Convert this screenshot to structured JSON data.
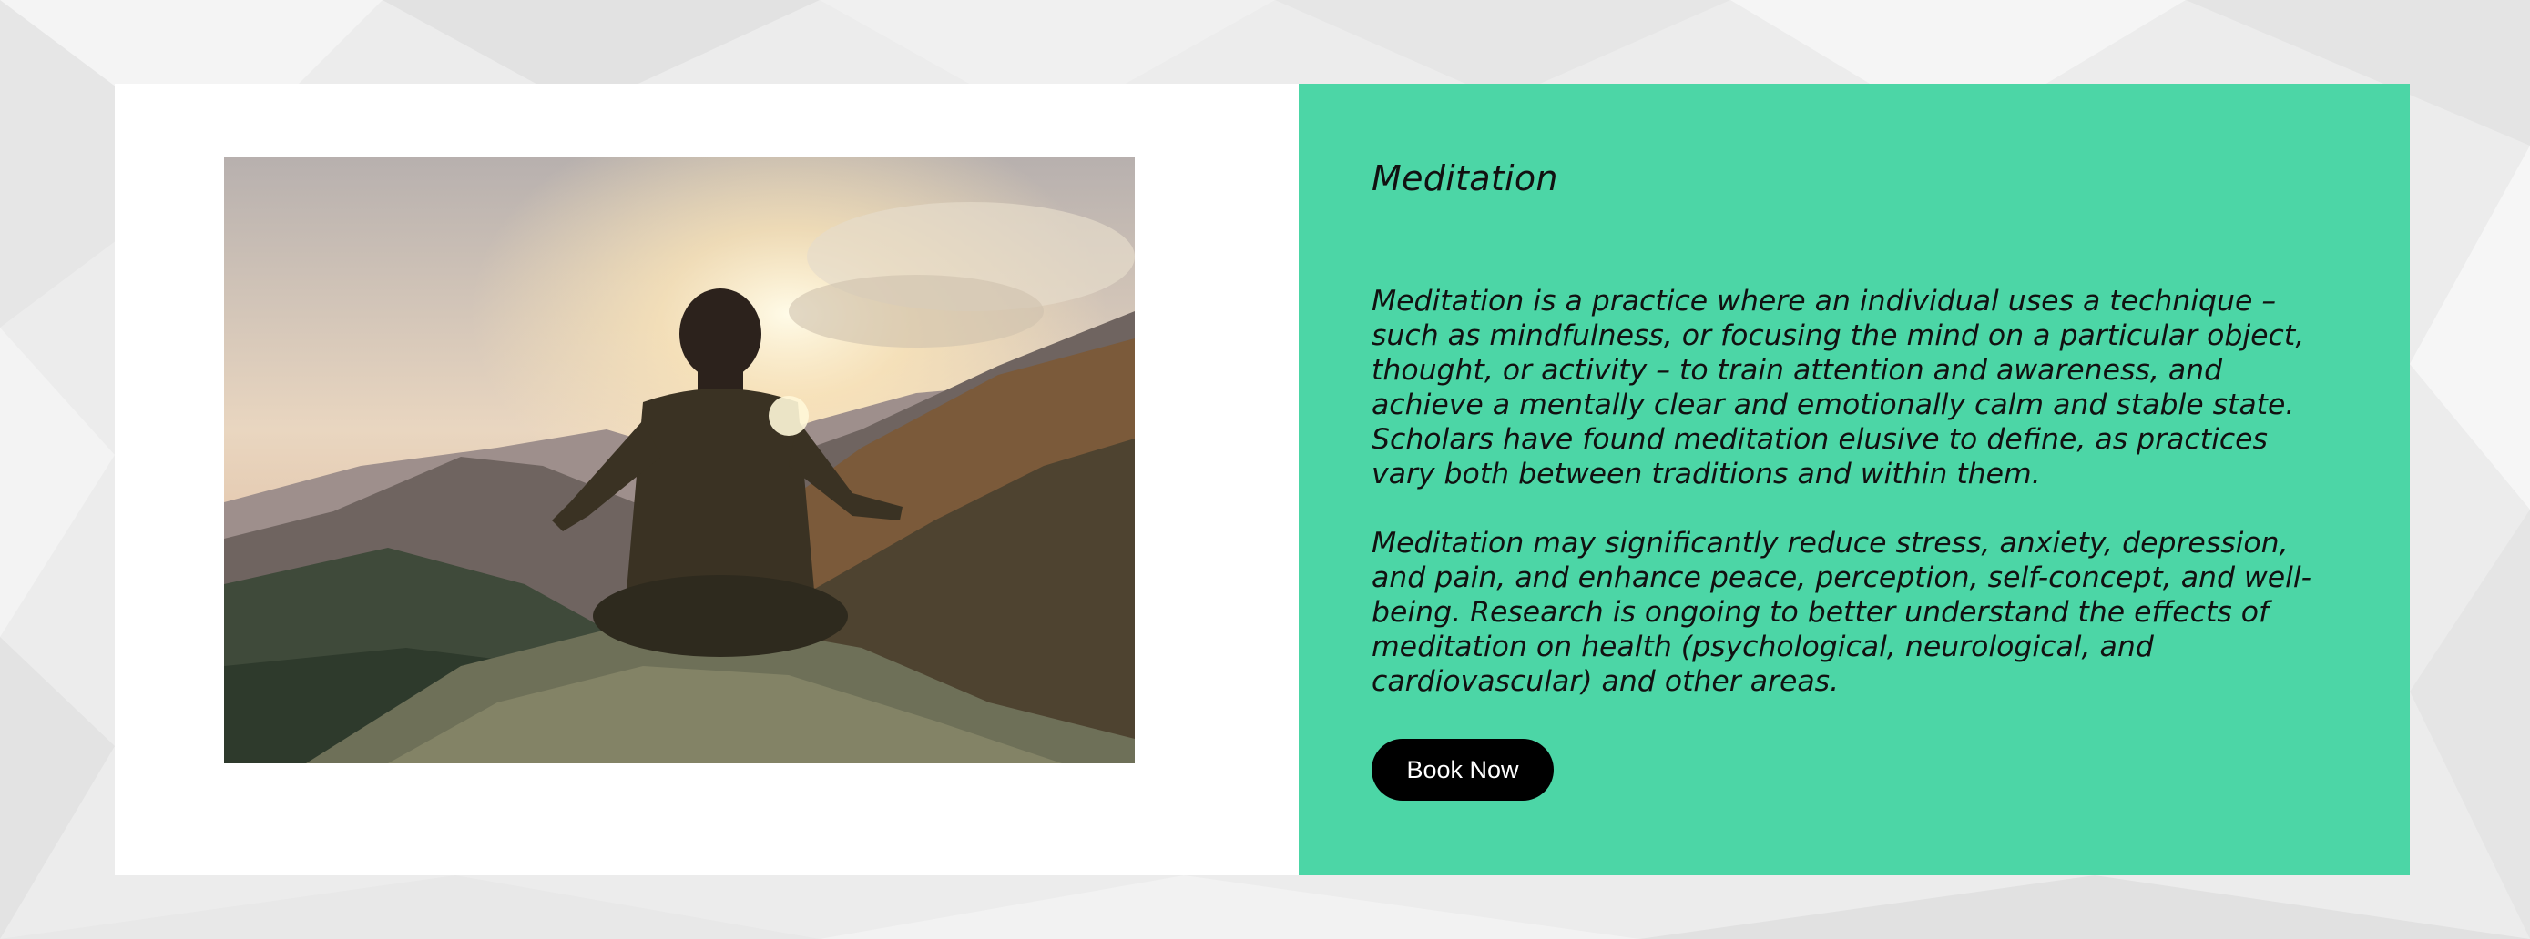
{
  "section": {
    "image_alt": "Person meditating cross-legged on a mountain rock at sunset",
    "title": "Meditation",
    "paragraphs": [
      "Meditation is a practice where an individual uses a technique – such as mindfulness, or focusing the mind on a particular object, thought, or activity – to train attention and awareness, and achieve a mentally clear and emotionally calm and stable state. Scholars have found meditation elusive to define, as practices vary both between traditions and within them.",
      "Meditation may significantly reduce stress, anxiety, depression, and pain, and enhance peace, perception, self-concept, and well-being. Research is ongoing to better understand the effects of meditation on health (psychological, neurological, and cardiovascular) and other areas."
    ],
    "button_label": "Book Now"
  },
  "colors": {
    "panel_bg": "#4cd6a6",
    "button_bg": "#000000",
    "button_text": "#ffffff",
    "page_bg": "#ececec",
    "card_bg": "#ffffff"
  }
}
